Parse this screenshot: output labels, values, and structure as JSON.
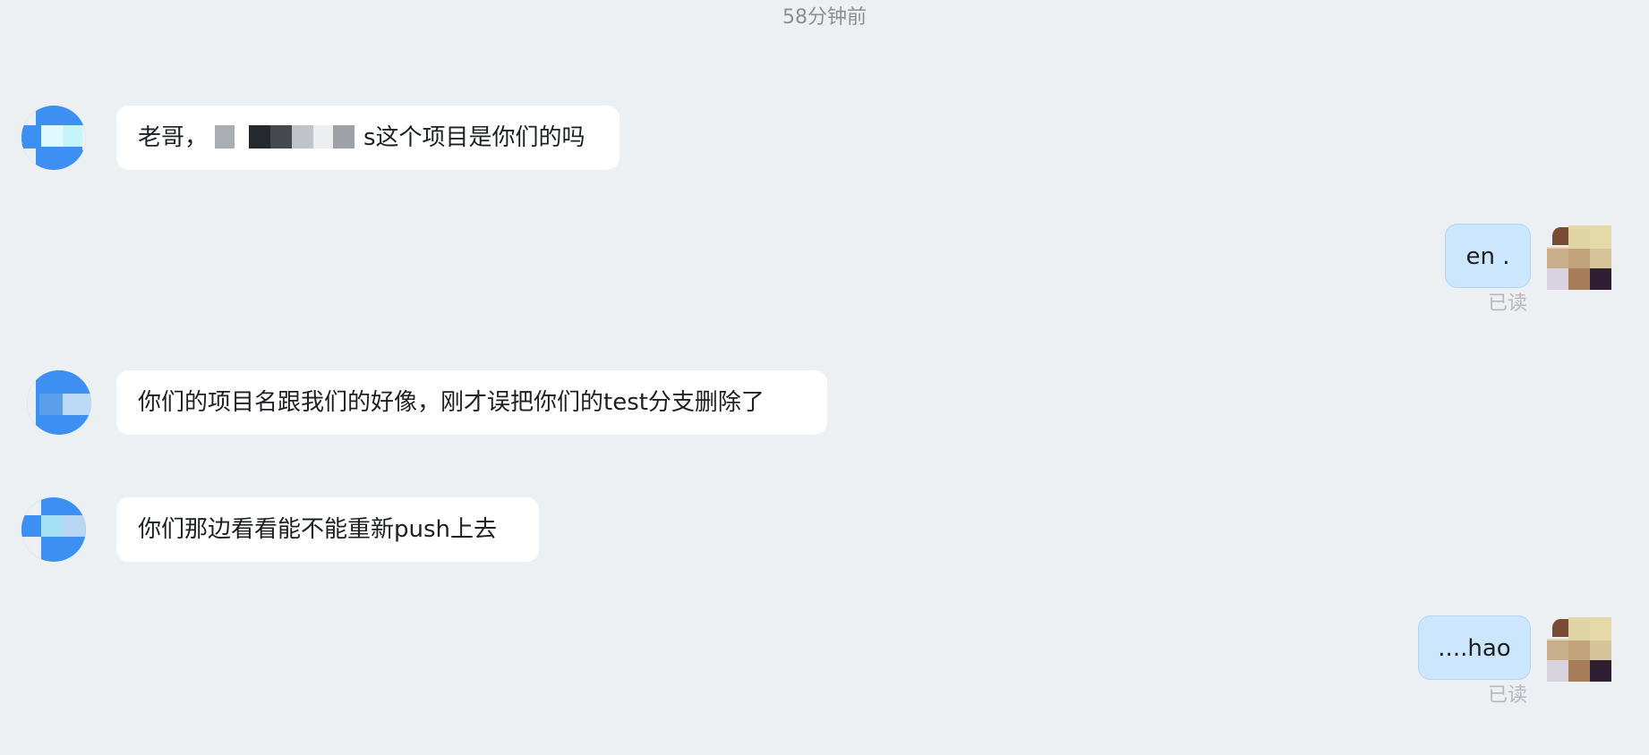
{
  "time_divider": "58分钟前",
  "messages": [
    {
      "from": "other",
      "text_before": "老哥，",
      "text_after": "s这个项目是你们的吗",
      "redacted": true
    },
    {
      "from": "me",
      "text": "en .",
      "status": "已读"
    },
    {
      "from": "other",
      "text": "你们的项目名跟我们的好像，刚才误把你们的test分支删除了"
    },
    {
      "from": "other",
      "text": "你们那边看看能不能重新push上去"
    },
    {
      "from": "me",
      "text": "....hao",
      "status": "已读"
    }
  ],
  "colors": {
    "background": "#edf0f3",
    "incoming_bubble": "#ffffff",
    "outgoing_bubble": "#cce6fd",
    "other_avatar": "#3d8ff2"
  }
}
